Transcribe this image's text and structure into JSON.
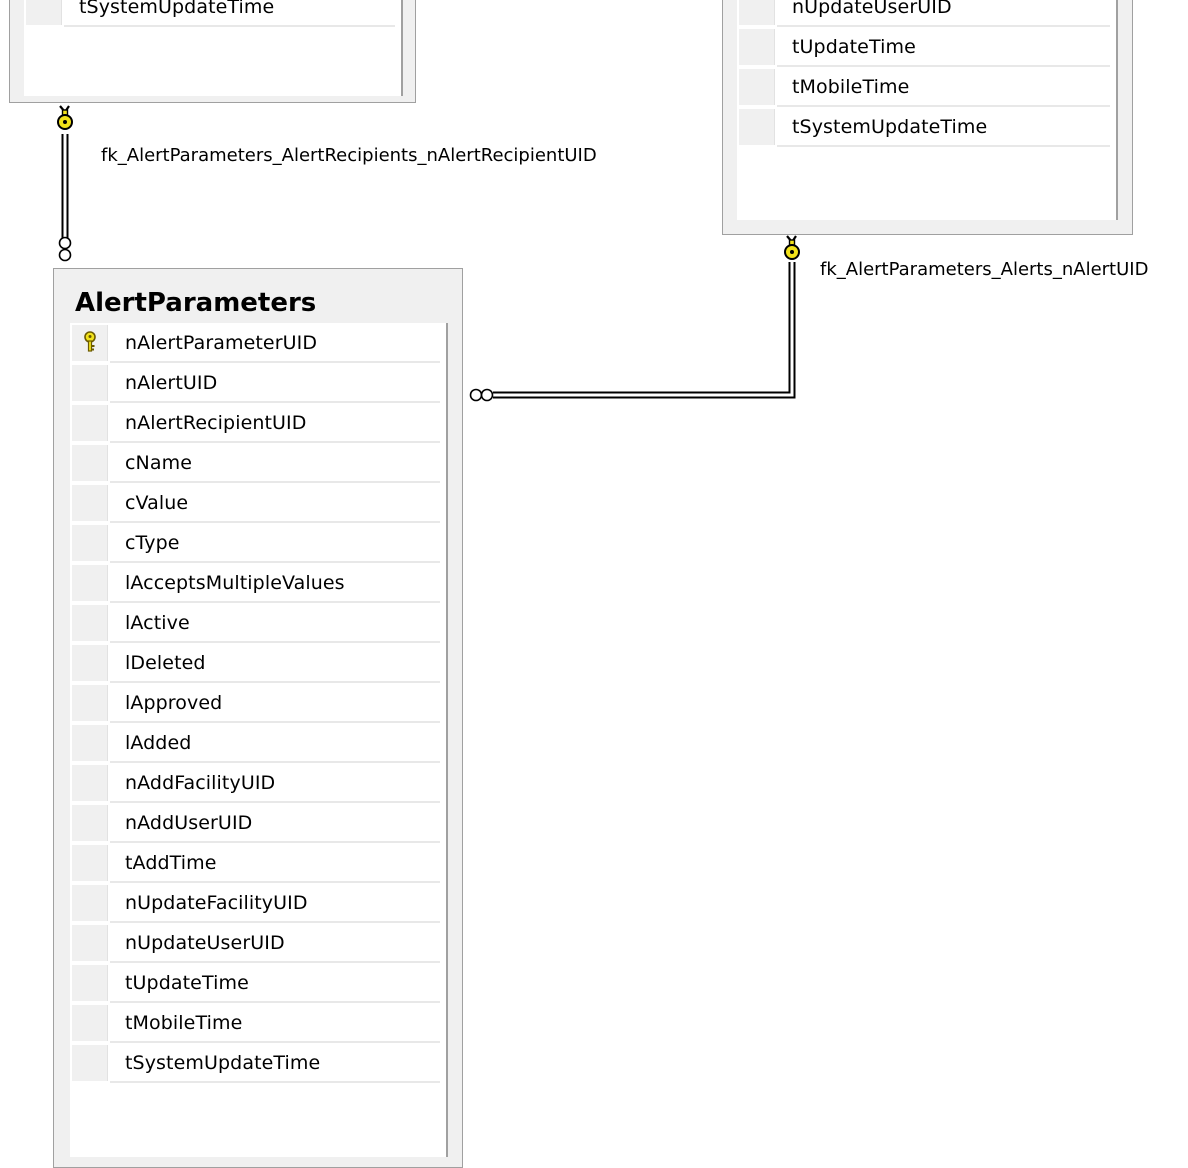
{
  "tables": {
    "alert_recipients_partial": {
      "visible_columns": [
        "tSystemUpdateTime"
      ]
    },
    "alerts_partial": {
      "visible_columns": [
        "nUpdateUserUID",
        "tUpdateTime",
        "tMobileTime",
        "tSystemUpdateTime"
      ]
    },
    "alert_parameters": {
      "title": "AlertParameters",
      "columns": [
        "nAlertParameterUID",
        "nAlertUID",
        "nAlertRecipientUID",
        "cName",
        "cValue",
        "cType",
        "lAcceptsMultipleValues",
        "lActive",
        "lDeleted",
        "lApproved",
        "lAdded",
        "nAddFacilityUID",
        "nAddUserUID",
        "tAddTime",
        "nUpdateFacilityUID",
        "nUpdateUserUID",
        "tUpdateTime",
        "tMobileTime",
        "tSystemUpdateTime"
      ],
      "primary_key_column": "nAlertParameterUID"
    }
  },
  "relationships": [
    {
      "name": "fk_AlertParameters_AlertRecipients_nAlertRecipientUID"
    },
    {
      "name": "fk_AlertParameters_Alerts_nAlertUID"
    }
  ],
  "colors": {
    "key_icon_fill": "#f2e21a",
    "key_icon_stroke": "#6b5a00",
    "table_bg": "#f0f0f0",
    "grid_bg": "#ffffff",
    "border": "#a0a0a0"
  },
  "icons": {
    "primary_key": "key-icon",
    "relationship_one": "key-icon",
    "relationship_many": "infinity-icon"
  }
}
